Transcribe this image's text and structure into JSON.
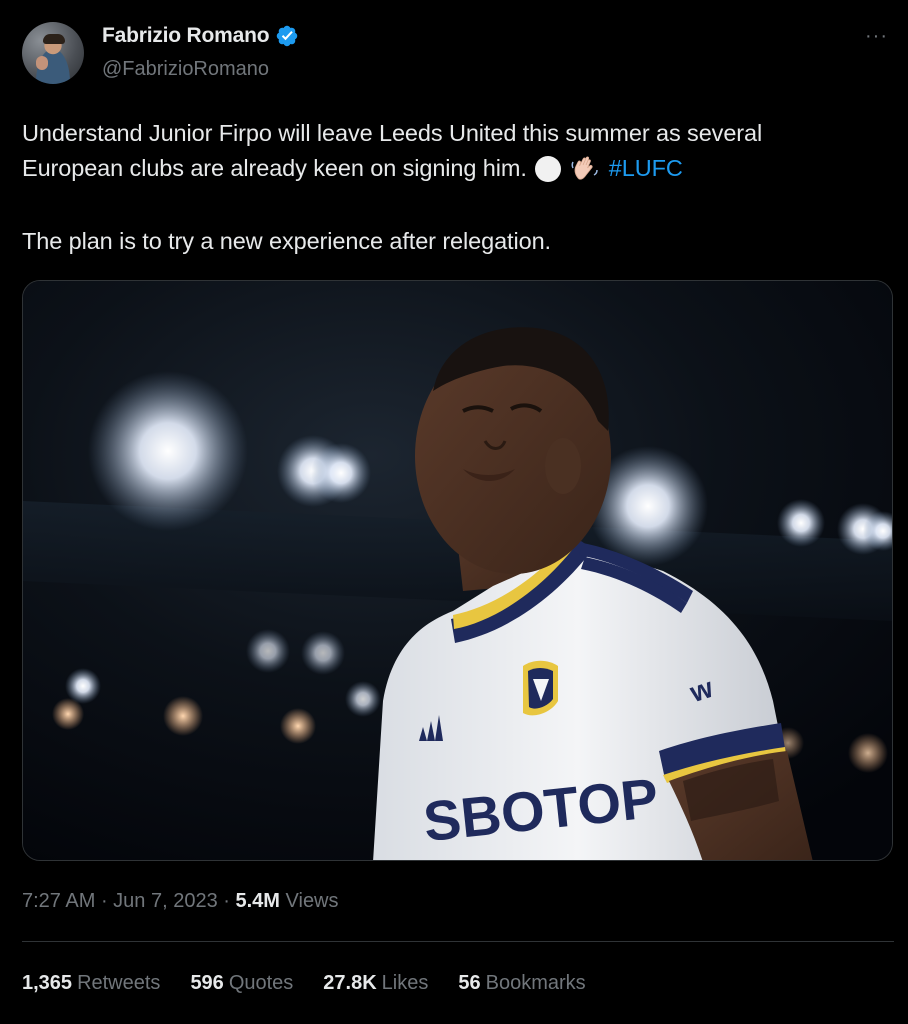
{
  "author": {
    "name": "Fabrizio Romano",
    "handle": "@FabrizioRomano",
    "verified_color": "#1d9bf0",
    "more_icon": "ellipsis-icon"
  },
  "tweet": {
    "line1": "Understand Junior Firpo will leave Leeds United this summer as several",
    "line2_text": "European clubs are already keen on signing him.",
    "line2_emojis": [
      "white-circle-emoji",
      "waving-hand-emoji"
    ],
    "hashtag": "#LUFC",
    "paragraph2": "The plan is to try a new experience after relegation."
  },
  "media": {
    "type": "photo",
    "shirt_text": "SBOTOP",
    "sleeve_text": "w"
  },
  "meta": {
    "time": "7:27 AM",
    "separator": " · ",
    "date": "Jun 7, 2023",
    "views_count": "5.4M",
    "views_label": "Views"
  },
  "stats": {
    "retweets_count": "1,365",
    "retweets_label": "Retweets",
    "quotes_count": "596",
    "quotes_label": "Quotes",
    "likes_count": "27.8K",
    "likes_label": "Likes",
    "bookmarks_count": "56",
    "bookmarks_label": "Bookmarks"
  },
  "colors": {
    "background": "#000000",
    "text": "#e7e9ea",
    "muted": "#71767b",
    "link": "#1d9bf0",
    "border": "#2f3336"
  }
}
